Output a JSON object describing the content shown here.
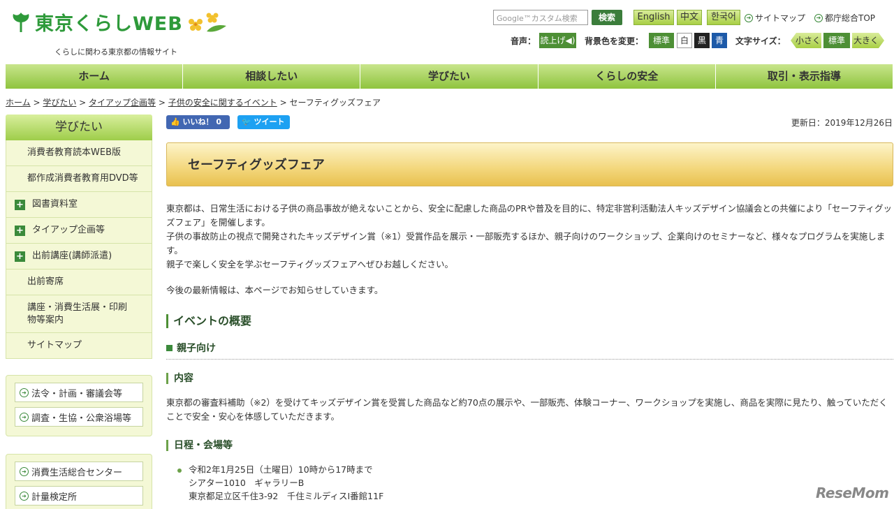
{
  "header": {
    "logo_text": "東京くらしWEB",
    "tagline": "くらしに関わる東京都の情報サイト",
    "search_placeholder": "Google™カスタム検索",
    "search_button": "検索",
    "lang": [
      "English",
      "中文",
      "한국어"
    ],
    "sitemap_link": "サイトマップ",
    "metro_top_link": "都庁総合TOP",
    "voice_label": "音声：",
    "voice_button": "読上げ◀)",
    "bg_label": "背景色を変更：",
    "bg_standard": "標準",
    "bg_white": "白",
    "bg_black": "黒",
    "bg_blue": "青",
    "fontsize_label": "文字サイズ：",
    "fs_small": "小さく",
    "fs_standard": "標準",
    "fs_large": "大きく"
  },
  "nav": [
    "ホーム",
    "相談したい",
    "学びたい",
    "くらしの安全",
    "取引・表示指導"
  ],
  "breadcrumb": {
    "items": [
      "ホーム",
      "学びたい",
      "タイアップ企画等",
      "子供の安全に関するイベント"
    ],
    "current": "セーフティグッズフェア",
    "sep": " > "
  },
  "sidebar": {
    "title": "学びたい",
    "items": [
      {
        "label": "消費者教育読本WEB版"
      },
      {
        "label": "都作成消費者教育用DVD等"
      },
      {
        "label": "図書資料室"
      },
      {
        "label": "タイアップ企画等"
      },
      {
        "label": "出前講座(講師派遣)"
      },
      {
        "label": "出前寄席"
      },
      {
        "label": "講座・消費生活展・印刷物等案内"
      },
      {
        "label": "サイトマップ"
      }
    ],
    "box1": [
      "法令・計画・審議会等",
      "調査・生協・公衆浴場等"
    ],
    "box2": [
      "消費生活総合センター",
      "計量検定所"
    ]
  },
  "content": {
    "like_button": "いいね！ 0",
    "tweet_button": "ツイート",
    "updated": "更新日：2019年12月26日",
    "title": "セーフティグッズフェア",
    "intro_1": "東京都は、日常生活における子供の商品事故が絶えないことから、安全に配慮した商品のPRや普及を目的に、特定非営利活動法人キッズデザイン協議会との共催により「セーフティグッズフェア」を開催します。",
    "intro_2": "子供の事故防止の視点で開発されたキッズデザイン賞（※1）受賞作品を展示・一部販売するほか、親子向けのワークショップ、企業向けのセミナーなど、様々なプログラムを実施します。",
    "intro_3": "親子で楽しく安全を学ぶセーフティグッズフェアへぜひお越しください。",
    "notice": "今後の最新情報は、本ページでお知らせしていきます。",
    "section_overview": "イベントの概要",
    "sub_family": "親子向け",
    "h_content": "内容",
    "content_text": "東京都の審査料補助（※2）を受けてキッズデザイン賞を受賞した商品など約70点の展示や、一部販売、体験コーナー、ワークショップを実施し、商品を実際に見たり、触っていただくことで安全・安心を体感していただきます。",
    "h_schedule": "日程・会場等",
    "schedule": {
      "date": "令和2年1月25日（土曜日）10時から17時まで",
      "venue": "シアター1010　ギャラリーB",
      "address": "東京都足立区千住3-92　千住ミルディスⅠ番館11F"
    }
  },
  "watermark": "ReseMom",
  "colors": {
    "brand_green": "#2e9a3a",
    "nav_green": "#8fc43e",
    "title_gold": "#e8c04f"
  }
}
